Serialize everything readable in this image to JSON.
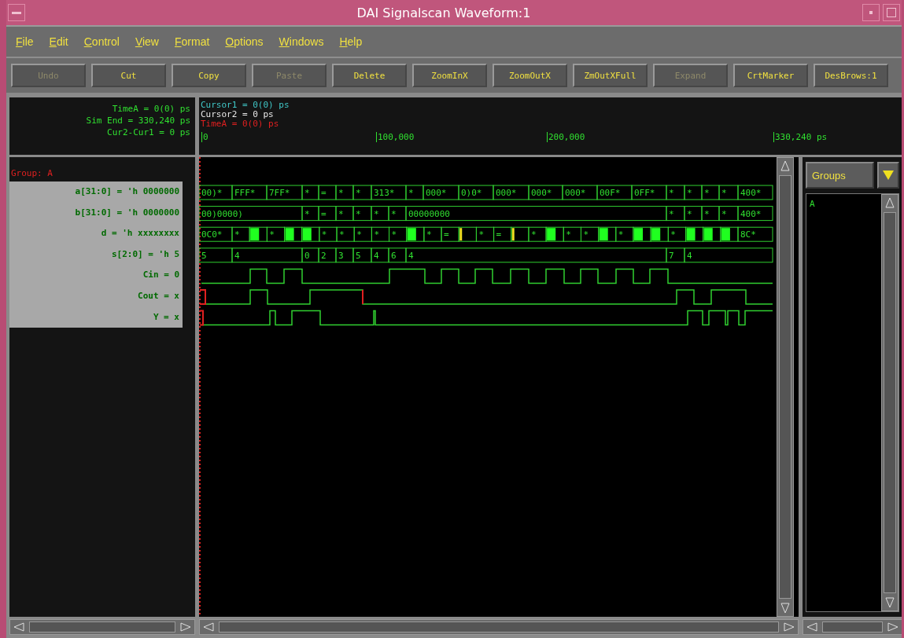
{
  "window": {
    "title": "DAI Signalscan Waveform:1"
  },
  "menu": [
    {
      "label": "File"
    },
    {
      "label": "Edit"
    },
    {
      "label": "Control"
    },
    {
      "label": "View"
    },
    {
      "label": "Format"
    },
    {
      "label": "Options"
    },
    {
      "label": "Windows"
    },
    {
      "label": "Help"
    }
  ],
  "toolbar": [
    {
      "label": "Undo",
      "disabled": true
    },
    {
      "label": "Cut",
      "disabled": false
    },
    {
      "label": "Copy",
      "disabled": false
    },
    {
      "label": "Paste",
      "disabled": true
    },
    {
      "label": "Delete",
      "disabled": false
    },
    {
      "label": "ZoomInX",
      "disabled": false
    },
    {
      "label": "ZoomOutX",
      "disabled": false
    },
    {
      "label": "ZmOutXFull",
      "disabled": false
    },
    {
      "label": "Expand",
      "disabled": true
    },
    {
      "label": "CrtMarker",
      "disabled": false
    },
    {
      "label": "DesBrows:1",
      "disabled": false
    }
  ],
  "time_info": [
    "TimeA = 0(0) ps",
    "Sim End = 330,240 ps",
    "Cur2-Cur1 = 0 ps"
  ],
  "cursors": [
    {
      "kind": "cursor1",
      "text": "Cursor1 = 0(0) ps"
    },
    {
      "kind": "cursor2",
      "text": "Cursor2 = 0 ps"
    },
    {
      "kind": "timea",
      "text": "TimeA = 0(0) ps"
    }
  ],
  "ruler": [
    "0",
    "100,000",
    "200,000",
    "330,240 ps"
  ],
  "group": "Group: A",
  "signals": [
    {
      "name": "a[31:0] = 'h 0000000",
      "kind": "bus",
      "segments": [
        {
          "kind": "value",
          "label": "00)*"
        },
        {
          "kind": "value",
          "label": "FFF*"
        },
        {
          "kind": "value",
          "label": "7FF*"
        },
        {
          "kind": "value",
          "label": "*"
        },
        {
          "kind": "value",
          "label": "="
        },
        {
          "kind": "value",
          "label": "*"
        },
        {
          "kind": "value",
          "label": "*"
        },
        {
          "kind": "value",
          "label": "313*"
        },
        {
          "kind": "value",
          "label": "*"
        },
        {
          "kind": "value",
          "label": "000*"
        },
        {
          "kind": "value",
          "label": "0)0*"
        },
        {
          "kind": "value",
          "label": "000*"
        },
        {
          "kind": "value",
          "label": "000*"
        },
        {
          "kind": "value",
          "label": "000*"
        },
        {
          "kind": "value",
          "label": "00F*"
        },
        {
          "kind": "value",
          "label": "0FF*"
        },
        {
          "kind": "value",
          "label": "*"
        },
        {
          "kind": "value",
          "label": "*"
        },
        {
          "kind": "value",
          "label": "*"
        },
        {
          "kind": "value",
          "label": "*"
        },
        {
          "kind": "value",
          "label": "400*"
        }
      ]
    },
    {
      "name": "b[31:0] = 'h 0000000",
      "kind": "bus",
      "segments": [
        {
          "kind": "value",
          "label": "00)0000)"
        },
        {
          "kind": "value",
          "label": "*"
        },
        {
          "kind": "value",
          "label": "="
        },
        {
          "kind": "value",
          "label": "*"
        },
        {
          "kind": "value",
          "label": "*"
        },
        {
          "kind": "value",
          "label": "*"
        },
        {
          "kind": "value",
          "label": "*"
        },
        {
          "kind": "value",
          "label": "00000000"
        },
        {
          "kind": "value",
          "label": "*"
        },
        {
          "kind": "value",
          "label": "*"
        },
        {
          "kind": "value",
          "label": "*"
        },
        {
          "kind": "value",
          "label": "*"
        },
        {
          "kind": "value",
          "label": "400*"
        }
      ]
    },
    {
      "name": "d = 'h xxxxxxxx",
      "kind": "bus",
      "segments": [
        {
          "kind": "value",
          "label": "0C0*"
        },
        {
          "kind": "value",
          "label": "*"
        },
        {
          "kind": "fill"
        },
        {
          "kind": "value",
          "label": "*"
        },
        {
          "kind": "fill"
        },
        {
          "kind": "fill"
        },
        {
          "kind": "value",
          "label": "*"
        },
        {
          "kind": "value",
          "label": "*"
        },
        {
          "kind": "value",
          "label": "*"
        },
        {
          "kind": "value",
          "label": "*"
        },
        {
          "kind": "value",
          "label": "*"
        },
        {
          "kind": "fill"
        },
        {
          "kind": "value",
          "label": "*"
        },
        {
          "kind": "value",
          "label": "="
        },
        {
          "kind": "mark"
        },
        {
          "kind": "value",
          "label": "*"
        },
        {
          "kind": "value",
          "label": "="
        },
        {
          "kind": "mark"
        },
        {
          "kind": "value",
          "label": "*"
        },
        {
          "kind": "fill"
        },
        {
          "kind": "value",
          "label": "*"
        },
        {
          "kind": "value",
          "label": "*"
        },
        {
          "kind": "fill"
        },
        {
          "kind": "value",
          "label": "*"
        },
        {
          "kind": "fill"
        },
        {
          "kind": "fill"
        },
        {
          "kind": "value",
          "label": "*"
        },
        {
          "kind": "fill"
        },
        {
          "kind": "fill"
        },
        {
          "kind": "fill"
        },
        {
          "kind": "value",
          "label": "8C*"
        }
      ]
    },
    {
      "name": "s[2:0] = 'h 5",
      "kind": "bus",
      "segments": [
        {
          "kind": "value",
          "label": "5"
        },
        {
          "kind": "value",
          "label": "4"
        },
        {
          "kind": "value",
          "label": "0"
        },
        {
          "kind": "value",
          "label": "2"
        },
        {
          "kind": "value",
          "label": "3"
        },
        {
          "kind": "value",
          "label": "5"
        },
        {
          "kind": "value",
          "label": "4"
        },
        {
          "kind": "value",
          "label": "6"
        },
        {
          "kind": "value",
          "label": "4"
        },
        {
          "kind": "value",
          "label": "7"
        },
        {
          "kind": "value",
          "label": "4"
        }
      ]
    },
    {
      "name": "Cin = 0",
      "kind": "bit"
    },
    {
      "name": "Cout = x",
      "kind": "bit"
    },
    {
      "name": "Y = x",
      "kind": "bit"
    }
  ],
  "groups_panel": {
    "dropdown": "Groups",
    "items": [
      "A"
    ]
  }
}
